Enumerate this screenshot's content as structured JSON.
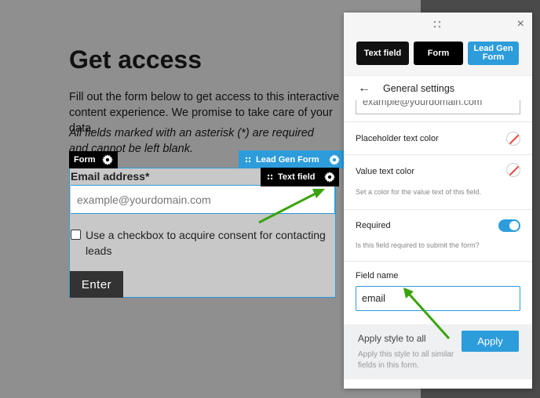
{
  "canvas": {
    "title": "Get access",
    "intro": "Fill out the form below to get access to this interactive content experience. We promise to take care of your data.",
    "note": "All fields marked with an asterisk (*) are required and cannot be left blank.",
    "tags": {
      "form": "Form",
      "lead_gen": "Lead Gen Form",
      "text_field": "Text field"
    },
    "email_label": "Email address*",
    "email_placeholder": "example@yourdomain.com",
    "consent_text": "Use a checkbox to acquire consent for contacting leads",
    "enter_label": "Enter"
  },
  "panel": {
    "close": "×",
    "breadcrumbs": [
      "Text field",
      "Form",
      "Lead Gen Form"
    ],
    "section_title": "General settings",
    "prev_input_value": "example@yourdomain.com",
    "placeholder_color_label": "Placeholder text color",
    "value_color_label": "Value text color",
    "value_color_help": "Set a color for the value text of this field.",
    "required_label": "Required",
    "required_on": true,
    "required_help": "Is this field required to submit the form?",
    "field_name_label": "Field name",
    "field_name_value": "email",
    "apply_all_label": "Apply style to all",
    "apply_all_help": "Apply this style to all similar fields in this form.",
    "apply_button": "Apply"
  },
  "colors": {
    "accent": "#2d9cdb",
    "arrow": "#3aa30c",
    "swatch_slash": "#e8453c"
  },
  "icons": [
    "gear-icon",
    "drag-handle-icon",
    "close-icon",
    "back-arrow-icon",
    "checkbox-icon"
  ]
}
